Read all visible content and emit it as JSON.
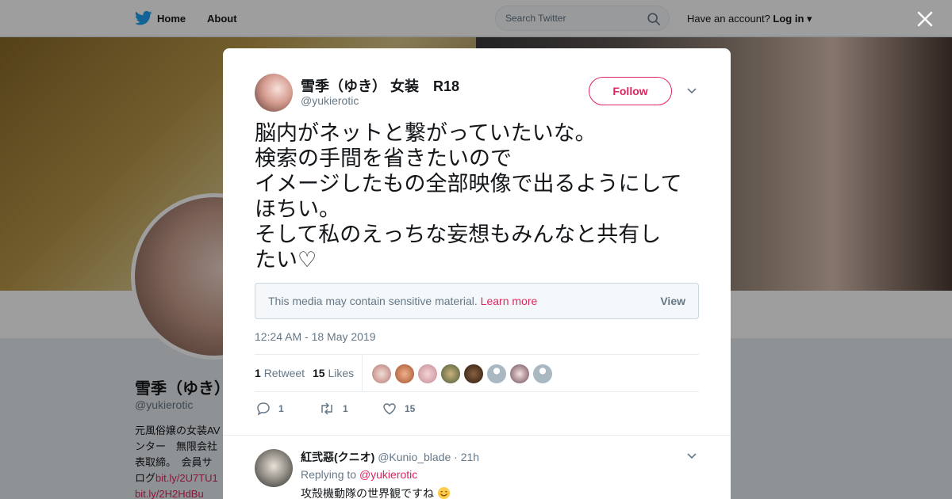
{
  "topbar": {
    "home_label": "Home",
    "about_label": "About",
    "search_placeholder": "Search Twitter",
    "account_prompt": "Have an account?",
    "login_label": "Log in"
  },
  "profile": {
    "name": "雪季（ゆき）",
    "handle": "@yukierotic",
    "bio_lines": [
      "元風俗嬢の女装AV",
      "ンター　無限会社",
      "表取締。　会員サ",
      "ログ"
    ],
    "bio_links": [
      "bit.ly/2U7TU1",
      "bit.ly/2H2HdBu"
    ]
  },
  "tweet": {
    "author_name": "雪季（ゆき） 女装　R18",
    "author_handle": "@yukierotic",
    "follow_label": "Follow",
    "text_lines": [
      "脳内がネットと繋がっていたいな。",
      "検索の手間を省きたいので",
      "イメージしたもの全部映像で出るようにして",
      "ほちい。",
      "そして私のえっちな妄想もみんなと共有し",
      "たい♡"
    ],
    "sensitive_text": "This media may contain sensitive material.",
    "learn_more": "Learn more",
    "view_label": "View",
    "timestamp": "12:24 AM - 18 May 2019",
    "retweet_count": "1",
    "retweet_label": "Retweet",
    "likes_count": "15",
    "likes_label": "Likes",
    "reply_action_count": "1",
    "retweet_action_count": "1",
    "like_action_count": "15"
  },
  "reply": {
    "name": "紅弐惡(クニオ)",
    "handle": "@Kunio_blade",
    "time": "· 21h",
    "replying_to_label": "Replying to",
    "replying_to_handle": "@yukierotic",
    "text": "攻殻機動隊の世界観ですね"
  },
  "colors": {
    "accent": "#e0245e",
    "twitter_blue": "#1da1f2",
    "muted": "#657786"
  }
}
